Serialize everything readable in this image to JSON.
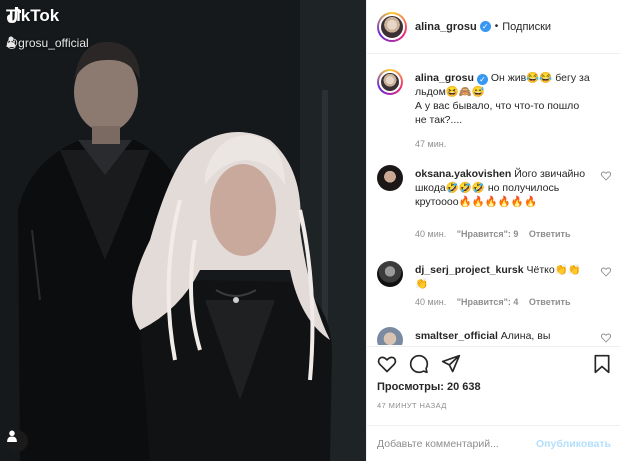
{
  "media": {
    "watermark": "TikTok",
    "handle": "@grosu_official",
    "icons": {
      "logo": "tiktok-logo-icon",
      "user": "user-icon"
    }
  },
  "header": {
    "username": "alina_grosu",
    "separator": "•",
    "follow_label": "Подписки"
  },
  "caption": {
    "username": "alina_grosu",
    "line1": "Он жив😂😂 бегу за льдом😆🙈😅",
    "line2": "А у вас бывало, что что-то пошло не так?....",
    "time": "47 мин."
  },
  "comments": [
    {
      "username": "oksana.yakovishen",
      "text": "Його звичайно шкода🤣🤣🤣 но получилось крутоооо🔥🔥🔥🔥🔥🔥",
      "time": "40 мин.",
      "likes": "\"Нравится\": 9",
      "reply": "Ответить"
    },
    {
      "username": "dj_serj_project_kursk",
      "text": "Чётко👏👏👏",
      "time": "40 мин.",
      "likes": "\"Нравится\": 4",
      "reply": "Ответить"
    },
    {
      "username": "smaltser_official",
      "text": "Алина, вы",
      "time": "",
      "likes": "",
      "reply": ""
    }
  ],
  "stats": {
    "views_label": "Просмотры: 20 638",
    "time_ago": "47 МИНУТ НАЗАД"
  },
  "comment_box": {
    "placeholder": "Добавьте комментарий...",
    "publish_label": "Опубликовать"
  },
  "colors": {
    "verified": "#3897f0",
    "publish_disabled": "#b2dffc",
    "muted": "#8e8e8e"
  }
}
